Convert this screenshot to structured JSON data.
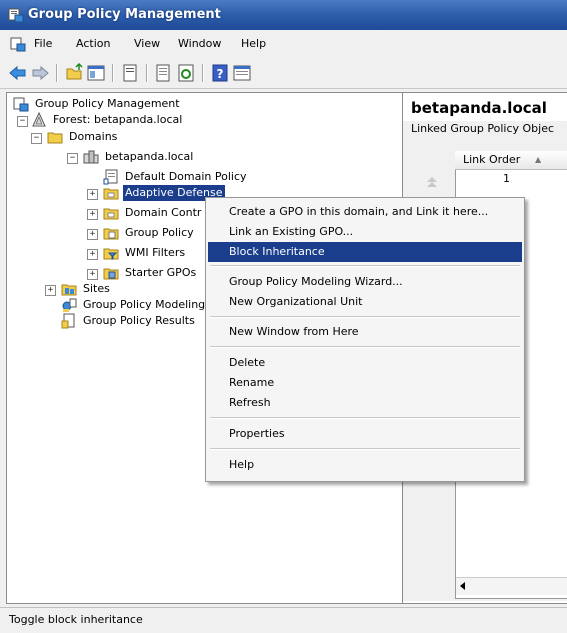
{
  "window": {
    "title": "Group Policy Management"
  },
  "menu": [
    "File",
    "Action",
    "View",
    "Window",
    "Help"
  ],
  "tree": {
    "root": "Group Policy Management",
    "forest": "Forest: betapanda.local",
    "domains": "Domains",
    "domain": "betapanda.local",
    "children": [
      "Default Domain Policy",
      "Adaptive Defense",
      "Domain Contr",
      "Group Policy",
      "WMI Filters",
      "Starter GPOs"
    ],
    "sites": "Sites",
    "modeling": "Group Policy Modeling",
    "results": "Group Policy Results"
  },
  "right_pane": {
    "title": "betapanda.local",
    "tab": "Linked Group Policy Objec",
    "column": "Link Order",
    "sort_glyph": "▲",
    "row_value": "1"
  },
  "context_menu": {
    "items": [
      "Create a GPO in this domain, and Link it here...",
      "Link an Existing GPO...",
      "Block Inheritance",
      "Group Policy Modeling Wizard...",
      "New Organizational Unit",
      "New Window from Here",
      "Delete",
      "Rename",
      "Refresh",
      "Properties",
      "Help"
    ],
    "highlighted": "Block Inheritance"
  },
  "status": "Toggle block inheritance",
  "colors": {
    "title_bar": "#2b5aa8",
    "selection": "#1a3e8c"
  }
}
